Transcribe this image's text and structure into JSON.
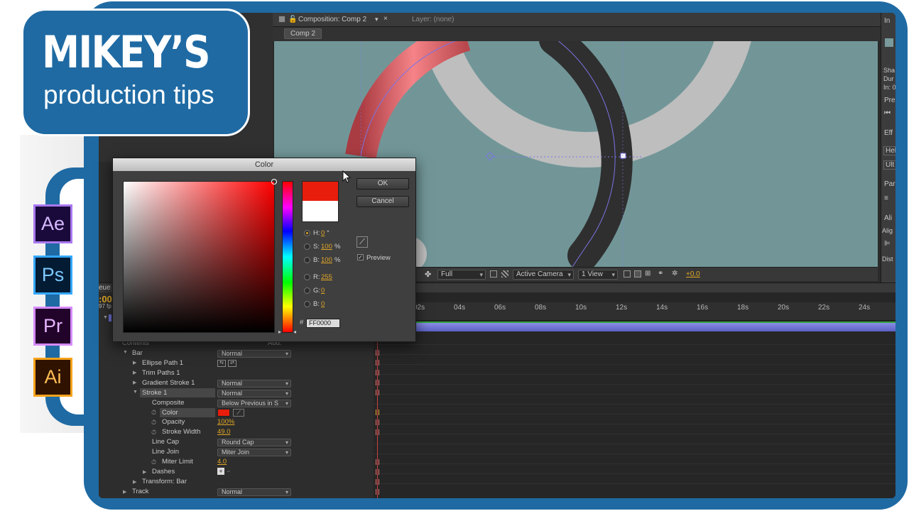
{
  "badge": {
    "title": "MIKEY’S",
    "subtitle": "production tips"
  },
  "app_icons": [
    {
      "label": "Ae",
      "bg": "#1a0a3b",
      "border": "#a979ef",
      "color": "#d6b9ff"
    },
    {
      "label": "Ps",
      "bg": "#031b33",
      "border": "#34a8ff",
      "color": "#7cc8ff"
    },
    {
      "label": "Pr",
      "bg": "#22042a",
      "border": "#d68aff",
      "color": "#e6b4ff"
    },
    {
      "label": "Ai",
      "bg": "#2f1300",
      "border": "#f7a21b",
      "color": "#ffbe55"
    }
  ],
  "comp_panel": {
    "title": "Composition: Comp 2",
    "layer_label": "Layer: (none)",
    "tab": "Comp 2"
  },
  "viewer_toolbar": {
    "resolution": "Full",
    "camera": "Active Camera",
    "views": "1 View",
    "exposure": "+0.0"
  },
  "timeline": {
    "ruler_ticks": [
      "02s",
      "04s",
      "06s",
      "08s",
      "10s",
      "12s",
      "14s",
      "16s",
      "18s",
      "20s",
      "22s",
      "24s"
    ],
    "partial_header": "eue",
    "partial_time": ":00",
    "partial_fps": "97 fp",
    "properties": {
      "contents": "Contents",
      "add": "Add:",
      "bar": "Bar",
      "bar_mode": "Normal",
      "ellipse_path": "Ellipse Path 1",
      "trim_paths": "Trim Paths 1",
      "gradient_stroke": "Gradient Stroke 1",
      "gradient_mode": "Normal",
      "stroke": "Stroke 1",
      "stroke_mode": "Normal",
      "composite": "Composite",
      "composite_value": "Below Previous in S",
      "color": "Color",
      "opacity": "Opacity",
      "opacity_value": "100%",
      "stroke_width": "Stroke Width",
      "stroke_width_value": "49.0",
      "line_cap": "Line Cap",
      "line_cap_value": "Round Cap",
      "line_join": "Line Join",
      "line_join_value": "Miter Join",
      "miter_limit": "Miter Limit",
      "miter_limit_value": "4.0",
      "dashes": "Dashes",
      "transform": "Transform: Bar",
      "track": "Track",
      "track_mode": "Normal"
    }
  },
  "color_dialog": {
    "title": "Color",
    "ok": "OK",
    "cancel": "Cancel",
    "preview_label": "Preview",
    "h_label": "H:",
    "h_value": "0",
    "h_unit": "°",
    "s_label": "S:",
    "s_value": "100",
    "s_unit": "%",
    "b_label": "B:",
    "b_value": "100",
    "b_unit": "%",
    "r_label": "R:",
    "r_value": "255",
    "g_label": "G:",
    "g_value": "0",
    "b2_label": "B:",
    "b2_value": "0",
    "hash": "#",
    "hex": "FF0000",
    "new_color": "#e81d0c",
    "old_color": "#ffffff"
  },
  "right_panel": {
    "labels": [
      "In",
      "Sha",
      "Dur",
      "In: 0",
      "Pre",
      "Eff",
      "Hel",
      "Ult",
      "Par",
      "Ali",
      "Alig",
      "Dist"
    ]
  },
  "colors": {
    "frame_blue": "#1f6aa3",
    "viewer_bg": "#729698",
    "accent_orange": "#e0a726",
    "timeline_bar": "#6b6fd6"
  }
}
